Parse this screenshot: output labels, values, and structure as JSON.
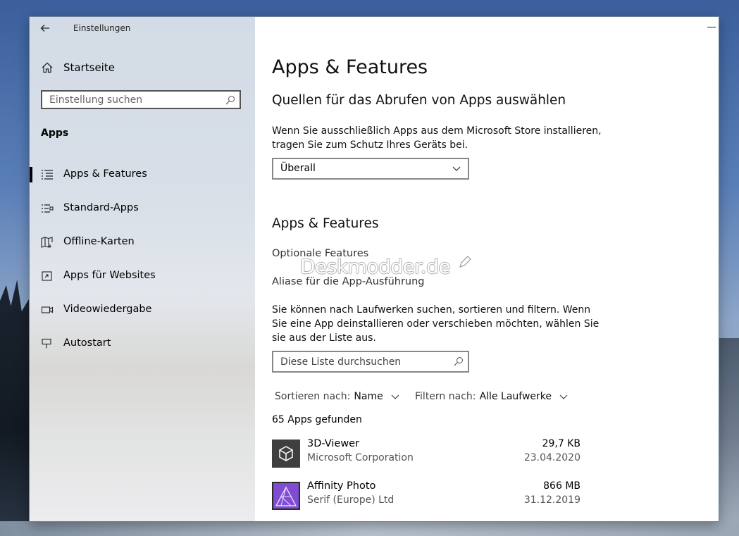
{
  "window": {
    "title": "Einstellungen"
  },
  "sidebar": {
    "home_label": "Startseite",
    "search_placeholder": "Einstellung suchen",
    "section_title": "Apps",
    "items": [
      {
        "label": "Apps & Features",
        "icon": "list-icon",
        "active": true
      },
      {
        "label": "Standard-Apps",
        "icon": "default-apps-icon",
        "active": false
      },
      {
        "label": "Offline-Karten",
        "icon": "map-icon",
        "active": false
      },
      {
        "label": "Apps für Websites",
        "icon": "website-app-icon",
        "active": false
      },
      {
        "label": "Videowiedergabe",
        "icon": "video-icon",
        "active": false
      },
      {
        "label": "Autostart",
        "icon": "startup-icon",
        "active": false
      }
    ]
  },
  "main": {
    "page_title": "Apps & Features",
    "sources": {
      "heading": "Quellen für das Abrufen von Apps auswählen",
      "description": "Wenn Sie ausschließlich Apps aus dem Microsoft Store installieren, tragen Sie zum Schutz Ihres Geräts bei.",
      "dropdown_value": "Überall"
    },
    "features": {
      "heading": "Apps & Features",
      "link_optional": "Optionale Features",
      "link_aliases": "Aliase für die App-Ausführung",
      "description": "Sie können nach Laufwerken suchen, sortieren und filtern. Wenn Sie eine App deinstallieren oder verschieben möchten, wählen Sie sie aus der Liste aus.",
      "list_search_placeholder": "Diese Liste durchsuchen",
      "sort_label": "Sortieren nach:",
      "sort_value": "Name",
      "filter_label": "Filtern nach:",
      "filter_value": "Alle Laufwerke",
      "count_text": "65 Apps gefunden"
    },
    "apps": [
      {
        "name": "3D-Viewer",
        "publisher": "Microsoft Corporation",
        "size": "29,7 KB",
        "date": "23.04.2020",
        "icon": "3d-viewer-icon",
        "icon_color": "#3f3f3f"
      },
      {
        "name": "Affinity Photo",
        "publisher": "Serif (Europe) Ltd",
        "size": "866 MB",
        "date": "31.12.2019",
        "icon": "affinity-photo-icon",
        "icon_color": "#7e4dd2"
      }
    ]
  },
  "watermark": {
    "text": "Deskmodder.de"
  },
  "colors": {
    "sidebar_bg": "#d8dfe8",
    "active_indicator": "#000000",
    "main_bg": "#ffffff"
  }
}
